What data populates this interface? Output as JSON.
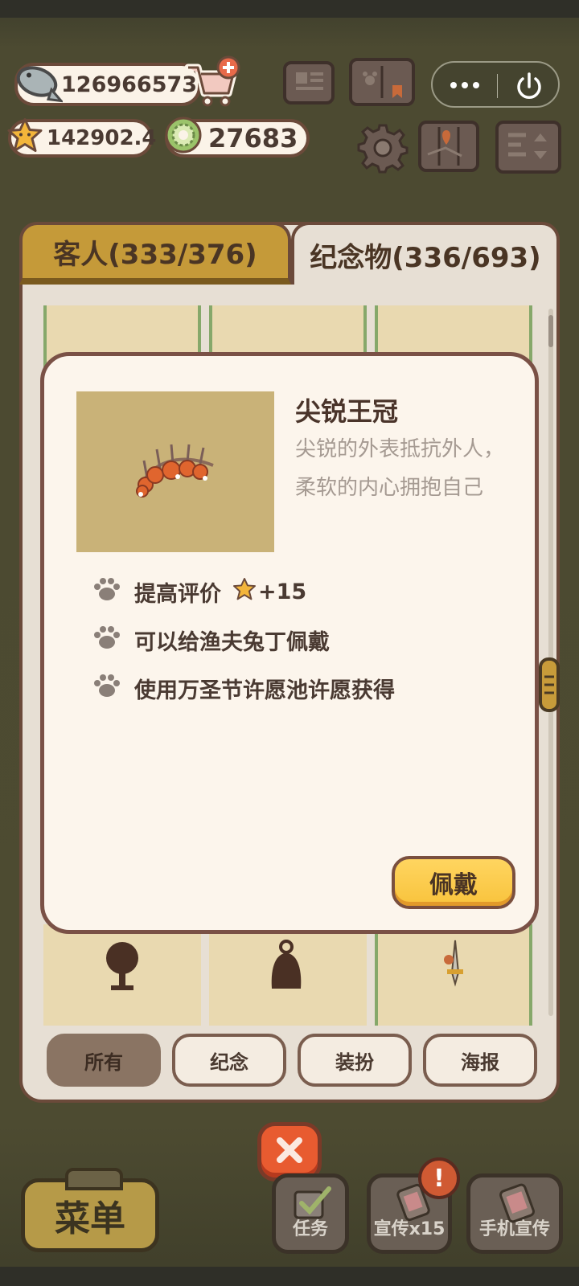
{
  "currencies": {
    "fish": "126966573",
    "stars": "142902.4",
    "coins": "27683"
  },
  "tabs": {
    "guests": "客人(333/376)",
    "souvenirs": "纪念物(336/693)"
  },
  "item": {
    "name": "尖锐王冠",
    "description_line1": "尖锐的外表抵抗外人，",
    "description_line2": "柔软的内心拥抱自己",
    "features": [
      {
        "text": "提高评价",
        "bonus": "+15"
      },
      {
        "text": "可以给渔夫兔丁佩戴"
      },
      {
        "text": "使用万圣节许愿池许愿获得"
      }
    ],
    "wear_button": "佩戴"
  },
  "filters": [
    "所有",
    "纪念",
    "装扮",
    "海报"
  ],
  "active_filter": "所有",
  "bottom": {
    "menu": "菜单",
    "tasks": "任务",
    "promo": "宣传x15",
    "phone_promo": "手机宣传",
    "badge": "!"
  },
  "colors": {
    "accent_yellow": "#f8c33c",
    "close_red": "#e85b30",
    "panel_border": "#6b4a3a"
  },
  "icons": [
    "fish-icon",
    "cart-plus-icon",
    "star-icon",
    "coin-icon",
    "newspaper-icon",
    "book-icon",
    "more-dots-icon",
    "power-icon",
    "gear-icon",
    "map-icon",
    "sort-icon",
    "paw-icon",
    "close-icon"
  ]
}
